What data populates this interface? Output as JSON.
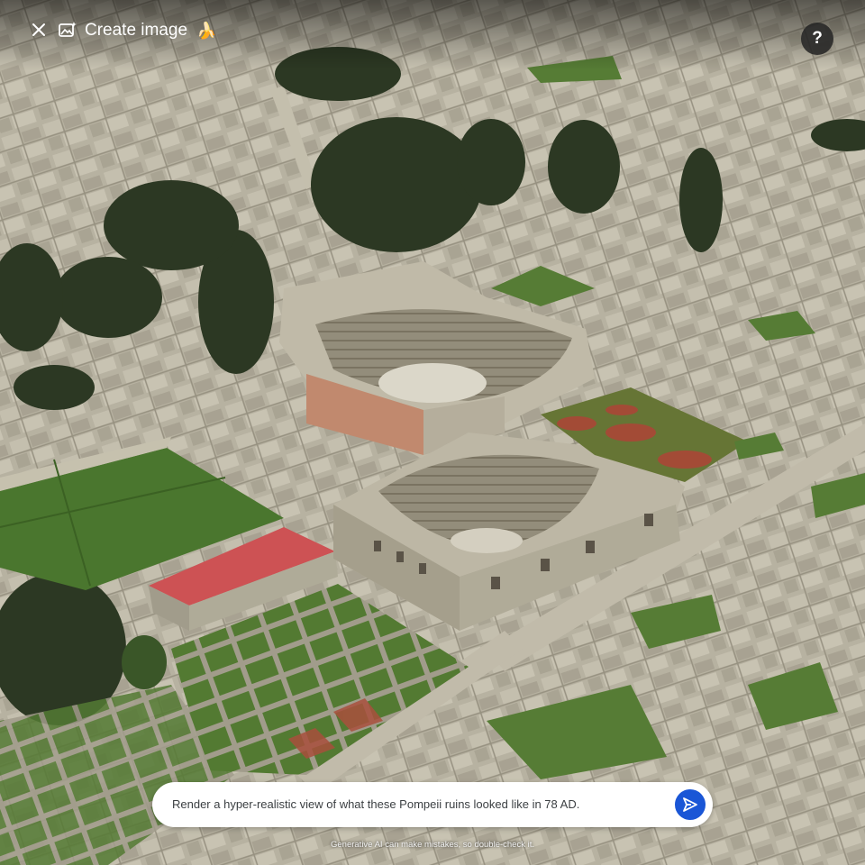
{
  "header": {
    "close_icon": "close-icon",
    "create_icon": "create-image-icon",
    "create_label": "Create image",
    "banana_glyph": "🍌",
    "help_label": "?"
  },
  "prompt": {
    "text": "Render a hyper-realistic view of what these Pompeii ruins looked like in 78 AD.",
    "send_icon": "send-icon",
    "send_color": "#1a56d6"
  },
  "footer": {
    "disclaimer": "Generative AI can make mistakes, so double-check it."
  },
  "colors": {
    "ruins": "#b9b5a4",
    "grass": "#4f7a32",
    "red_roof": "#d8585a",
    "trees": "#2d3a24"
  }
}
